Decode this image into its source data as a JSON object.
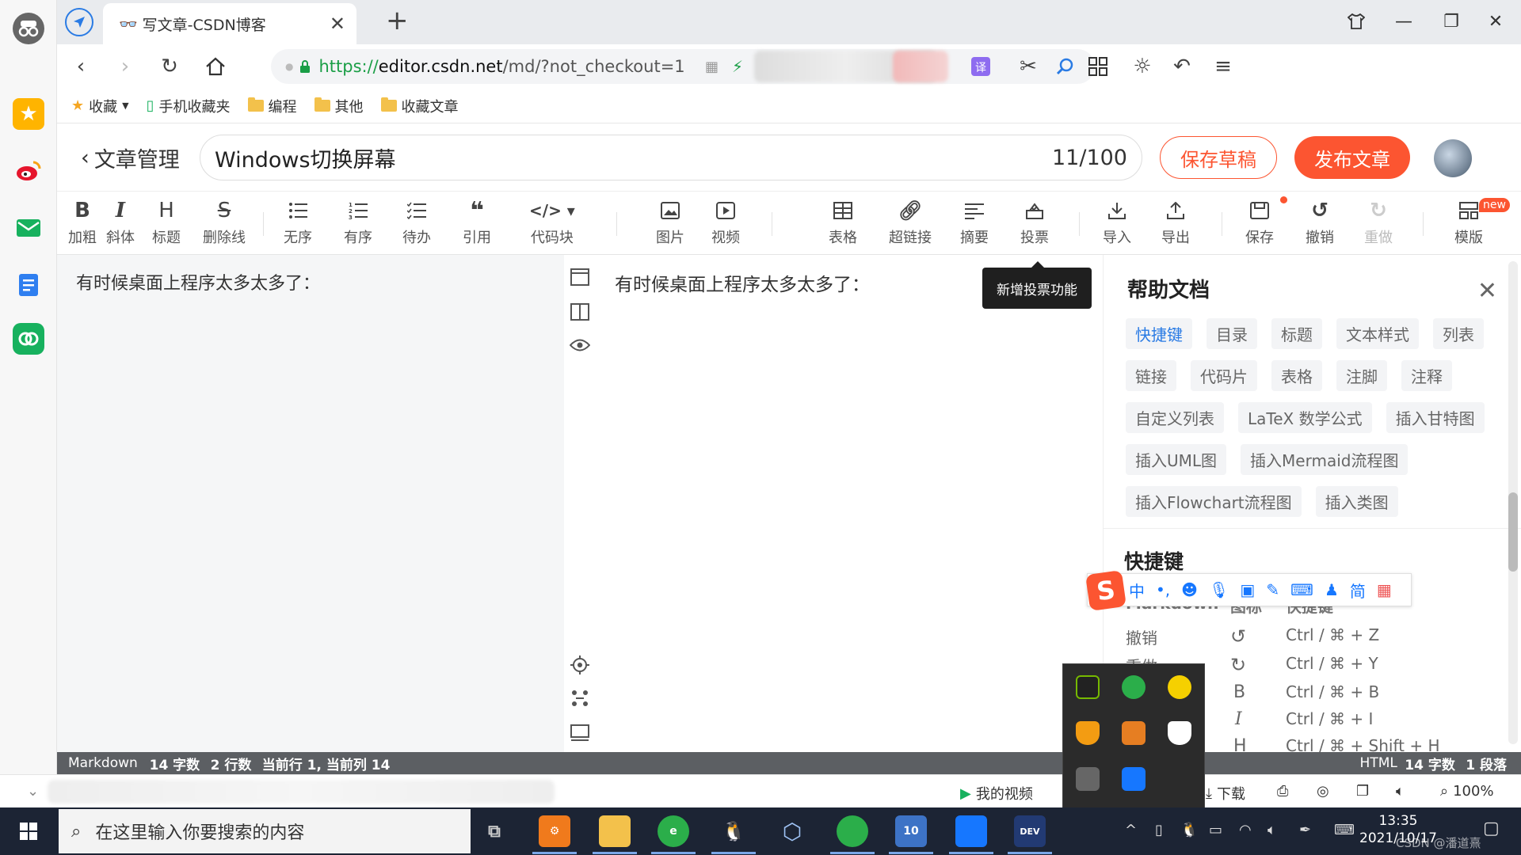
{
  "browser": {
    "tab_title": "写文章-CSDN博客",
    "url_scheme": "https://",
    "url_host": "editor.csdn.net",
    "url_path": "/md/?not_checkout=1",
    "bookmarks": [
      {
        "label": "收藏",
        "icon": "star-icon"
      },
      {
        "label": "手机收藏夹",
        "icon": "phone-icon"
      },
      {
        "label": "编程",
        "icon": "folder-icon"
      },
      {
        "label": "其他",
        "icon": "folder-icon"
      },
      {
        "label": "收藏文章",
        "icon": "folder-icon"
      }
    ]
  },
  "editor": {
    "back_label": "文章管理",
    "article_title": "Windows切换屏幕",
    "title_count": "11/100",
    "save_draft": "保存草稿",
    "publish": "发布文章",
    "toolbar": [
      {
        "icon": "B",
        "label": "加粗"
      },
      {
        "icon": "I",
        "label": "斜体"
      },
      {
        "icon": "H",
        "label": "标题"
      },
      {
        "icon": "S",
        "label": "删除线"
      },
      {
        "icon": "ul-icon",
        "label": "无序"
      },
      {
        "icon": "ol-icon",
        "label": "有序"
      },
      {
        "icon": "todo-icon",
        "label": "待办"
      },
      {
        "icon": "quote-icon",
        "label": "引用"
      },
      {
        "icon": "code-icon",
        "label": "代码块"
      },
      {
        "icon": "image-icon",
        "label": "图片"
      },
      {
        "icon": "video-icon",
        "label": "视频"
      },
      {
        "icon": "table-icon",
        "label": "表格"
      },
      {
        "icon": "link-icon",
        "label": "超链接"
      },
      {
        "icon": "summary-icon",
        "label": "摘要"
      },
      {
        "icon": "vote-icon",
        "label": "投票"
      },
      {
        "icon": "import-icon",
        "label": "导入"
      },
      {
        "icon": "export-icon",
        "label": "导出"
      },
      {
        "icon": "save-icon",
        "label": "保存"
      },
      {
        "icon": "undo-icon",
        "label": "撤销"
      },
      {
        "icon": "redo-icon",
        "label": "重做"
      },
      {
        "icon": "template-icon",
        "label": "模版"
      }
    ],
    "new_badge": "new",
    "markdown_text": "有时候桌面上程序太多太多了：",
    "preview_text": "有时候桌面上程序太多太多了：",
    "tooltip": "新增投票功能"
  },
  "help": {
    "title": "帮助文档",
    "chips": [
      "快捷键",
      "目录",
      "标题",
      "文本样式",
      "列表",
      "链接",
      "代码片",
      "表格",
      "注脚",
      "注释",
      "自定义列表",
      "LaTeX 数学公式",
      "插入甘特图",
      "插入UML图",
      "插入Mermaid流程图",
      "插入Flowchart流程图",
      "插入类图"
    ],
    "shortcuts_title": "快捷键",
    "columns": [
      "Markdown",
      "图标",
      "快捷键"
    ],
    "rows": [
      {
        "name": "撤销",
        "icon": "undo-icon",
        "keys": "Ctrl / ⌘ + Z"
      },
      {
        "name": "重做",
        "icon": "redo-icon",
        "keys": "Ctrl / ⌘ + Y"
      },
      {
        "name": "",
        "icon": "B",
        "keys": "Ctrl / ⌘ + B"
      },
      {
        "name": "",
        "icon": "I",
        "keys": "Ctrl / ⌘ + I"
      },
      {
        "name": "",
        "icon": "H",
        "keys": "Ctrl / ⌘ + Shift + H"
      }
    ]
  },
  "ime": {
    "mode": "中",
    "punct": "•,",
    "simp": "简"
  },
  "status": {
    "left_mode": "Markdown",
    "left_chars": "14 字数",
    "left_lines": "2 行数",
    "left_pos": "当前行 1, 当前列 14",
    "right_mode": "HTML",
    "right_chars": "14 字数",
    "right_paras": "1 段落"
  },
  "browser_status": {
    "my_video": "我的视频",
    "download": "下载",
    "zoom": "100%"
  },
  "taskbar": {
    "search_placeholder": "在这里输入你要搜索的内容",
    "time": "13:35",
    "date": "2021/10/17",
    "watermark": "CSDN @潘道熹"
  },
  "colors": {
    "brand": "#fc5531",
    "link": "#2a7be4",
    "status_bg": "#5c5f63",
    "taskbar": "#1c2434"
  }
}
